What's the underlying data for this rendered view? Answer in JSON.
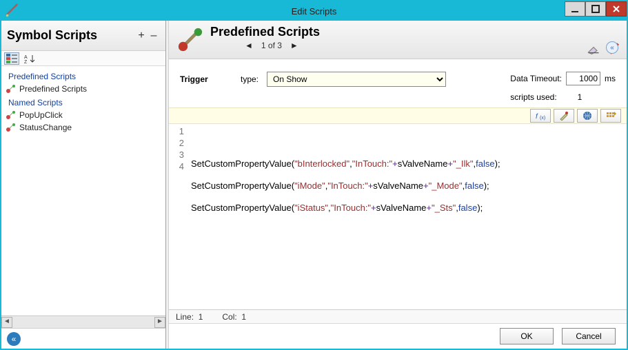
{
  "window": {
    "title": "Edit Scripts"
  },
  "left": {
    "heading": "Symbol Scripts",
    "groups": [
      {
        "label": "Predefined Scripts",
        "items": [
          {
            "label": "Predefined Scripts"
          }
        ]
      },
      {
        "label": "Named Scripts",
        "items": [
          {
            "label": "PopUpClick"
          },
          {
            "label": "StatusChange"
          }
        ]
      }
    ]
  },
  "right": {
    "heading": "Predefined Scripts",
    "pager": {
      "prev": "◄",
      "text": "1 of 3",
      "next": "►"
    },
    "trigger_label": "Trigger",
    "type_label": "type:",
    "type_value": "On Show",
    "data_timeout_label": "Data Timeout:",
    "data_timeout_value": "1000",
    "data_timeout_unit": "ms",
    "scripts_used_label": "scripts used:",
    "scripts_used_value": "1"
  },
  "code": {
    "lines": [
      {
        "fn": "SetCustomPropertyValue",
        "a": "\"bInterlocked\"",
        "b1": "\"InTouch:\"",
        "b2": "sValveName",
        "b3": "\"_Ilk\"",
        "c": "false"
      },
      {
        "fn": "SetCustomPropertyValue",
        "a": "\"iMode\"",
        "b1": "\"InTouch:\"",
        "b2": "sValveName",
        "b3": "\"_Mode\"",
        "c": "false"
      },
      {
        "fn": "SetCustomPropertyValue",
        "a": "\"iStatus\"",
        "b1": "\"InTouch:\"",
        "b2": "sValveName",
        "b3": "\"_Sts\"",
        "c": "false"
      }
    ]
  },
  "status": {
    "line_label": "Line:",
    "line": "1",
    "col_label": "Col:",
    "col": "1"
  },
  "buttons": {
    "ok": "OK",
    "cancel": "Cancel"
  },
  "icons": {
    "eraser": "eraser",
    "check": "check",
    "fx": "fx",
    "palette": "palette",
    "globe": "globe",
    "keypad": "keypad"
  }
}
